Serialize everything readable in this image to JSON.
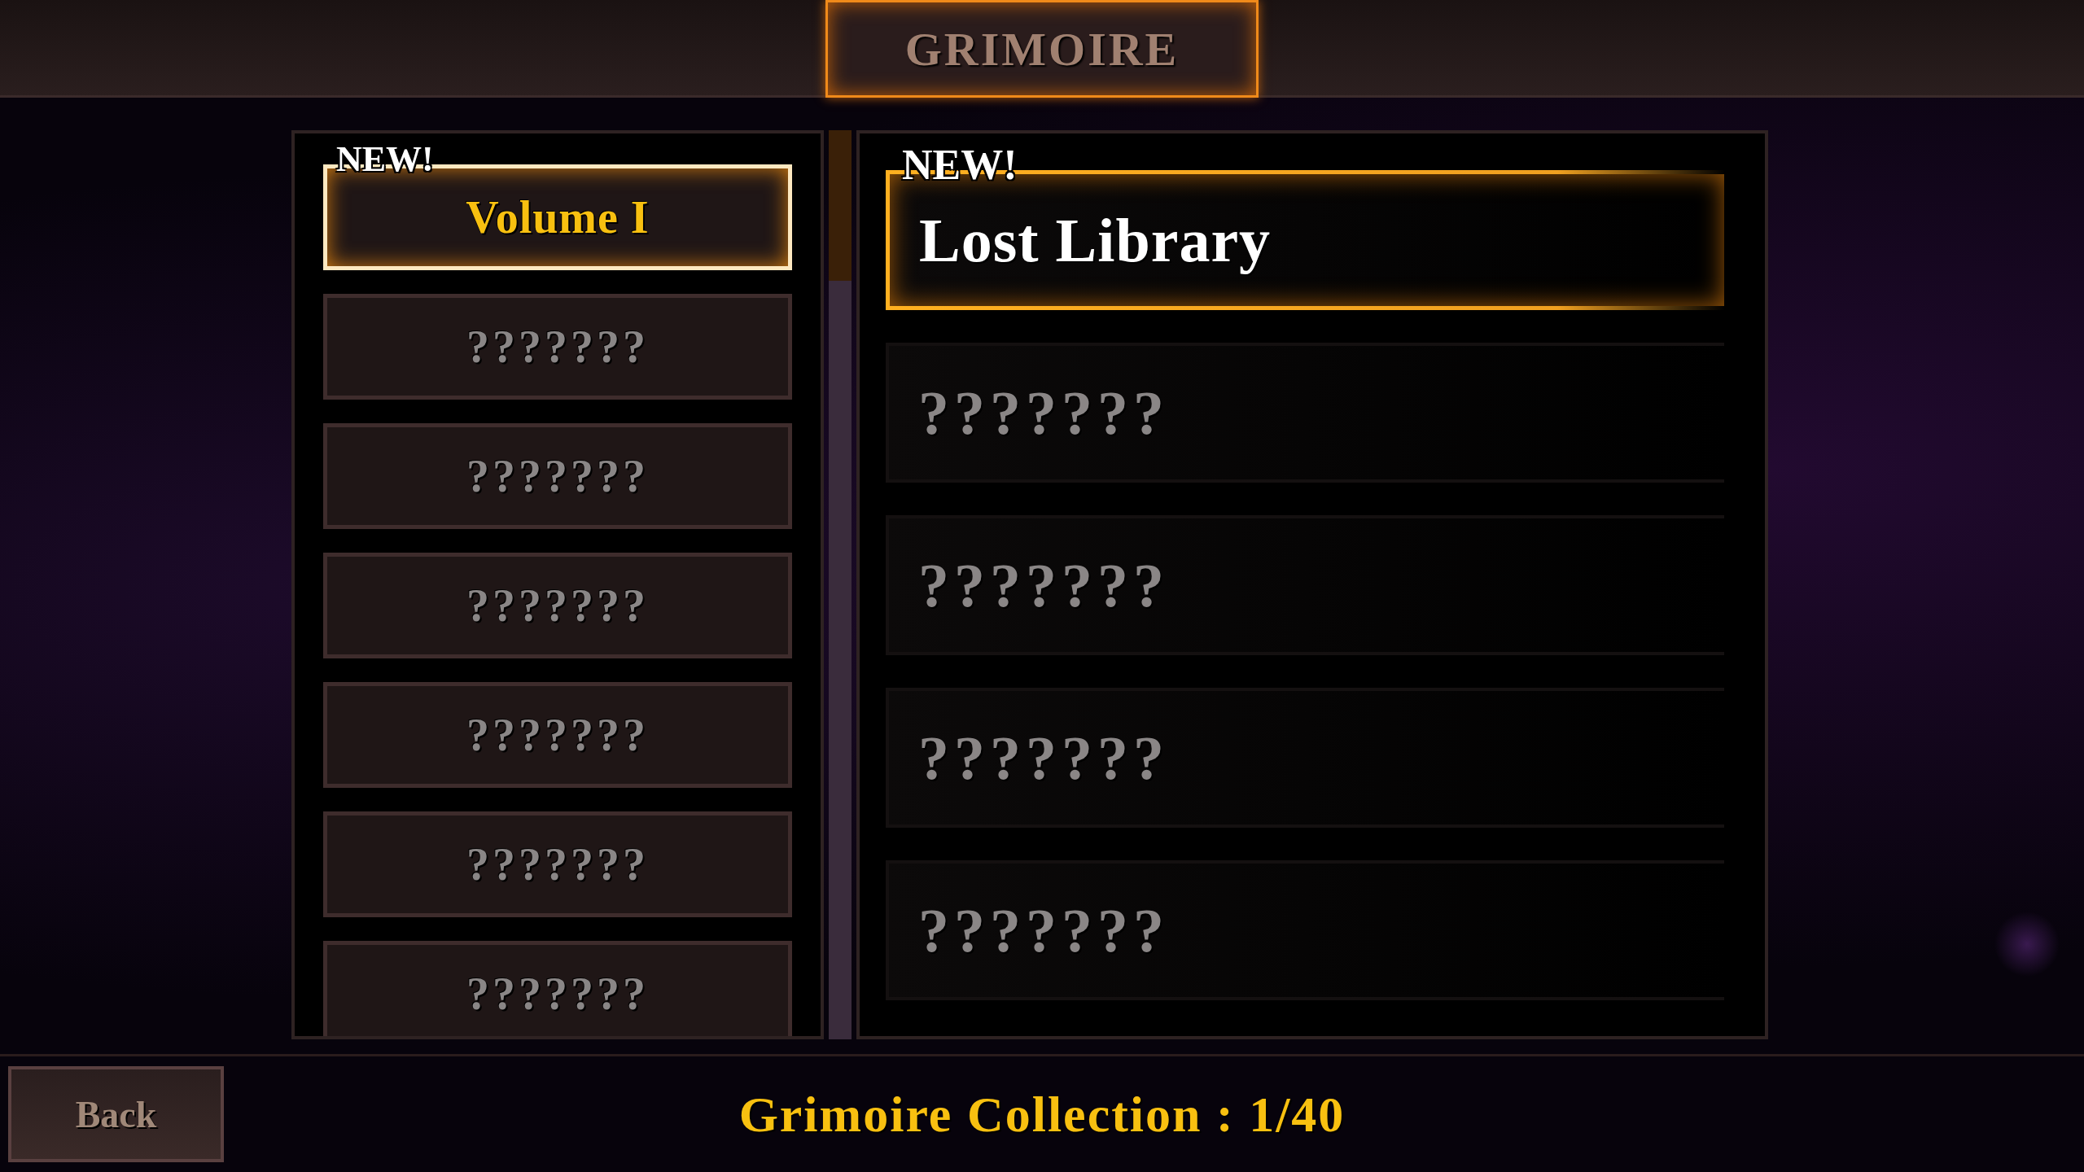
{
  "title": "GRIMOIRE",
  "volumes": [
    {
      "label": "Volume I",
      "badge": "NEW!",
      "selected": true
    },
    {
      "label": "???????",
      "selected": false
    },
    {
      "label": "???????",
      "selected": false
    },
    {
      "label": "???????",
      "selected": false
    },
    {
      "label": "???????",
      "selected": false
    },
    {
      "label": "???????",
      "selected": false
    },
    {
      "label": "???????",
      "selected": false
    }
  ],
  "entries": [
    {
      "label": "Lost Library",
      "badge": "NEW!",
      "selected": true
    },
    {
      "label": "???????",
      "selected": false
    },
    {
      "label": "???????",
      "selected": false
    },
    {
      "label": "???????",
      "selected": false
    },
    {
      "label": "???????",
      "selected": false
    }
  ],
  "back_button": "Back",
  "collection": "Grimoire Collection : 1/40"
}
